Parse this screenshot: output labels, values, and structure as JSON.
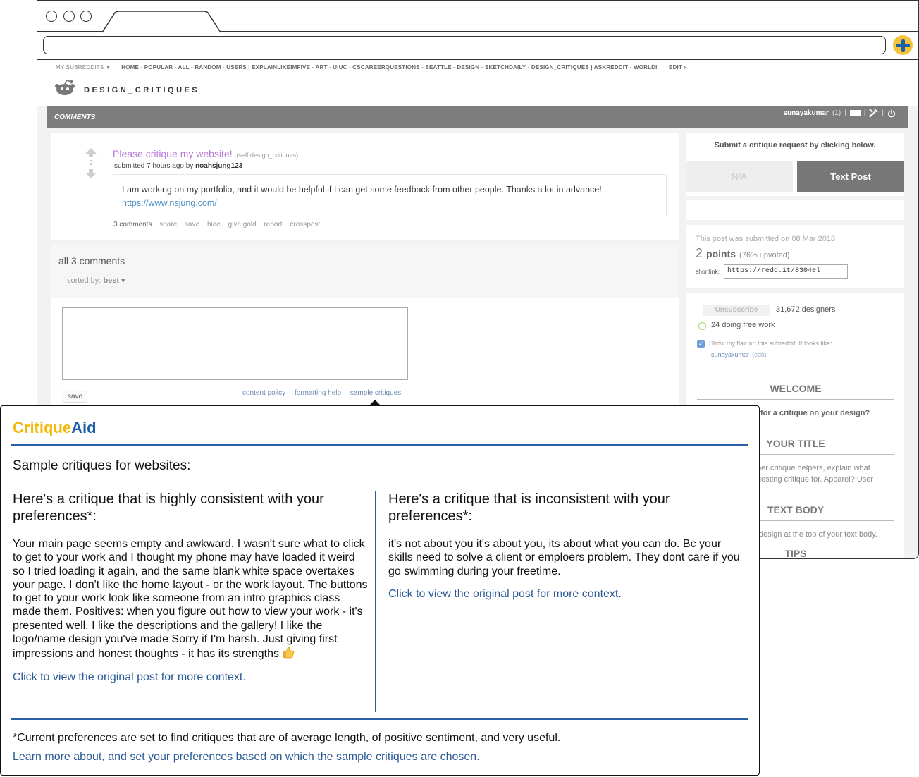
{
  "browser": {
    "address": ""
  },
  "reddit": {
    "srbar": {
      "my_subreddits": "MY SUBREDDITS ▼",
      "links": "HOME - POPULAR - ALL - RANDOM - USERS  |  EXPLAINLIKEIMFIVE - ART - UIUC - CSCAREERQUESTIONS - SEATTLE - DESIGN - SKETCHDAILY - DESIGN_CRITIQUES  |  ASKREDDIT - WORLDI",
      "edit": "EDIT »"
    },
    "subreddit_name": "DESIGN_CRITIQUES",
    "tab": "COMMENTS",
    "user": {
      "name": "sunayakumar",
      "karma": "(1)"
    },
    "post": {
      "score": "2",
      "title": "Please critique my website!",
      "domain": "(self.design_critiques)",
      "submitted_prefix": "submitted 7 hours ago by",
      "author": "noahsjung123",
      "selftext": "I am working on my portfolio, and it would be helpful if I can get some feedback from other people. Thanks a lot in advance!",
      "link": "https://www.nsjung.com/",
      "actions": [
        "3 comments",
        "share",
        "save",
        "hide",
        "give gold",
        "report",
        "crosspost"
      ]
    },
    "comments": {
      "all_label": "all 3 comments",
      "sorted_label": "sorted by:",
      "sort_value": "best ▾",
      "save_label": "save",
      "links": [
        "content policy",
        "formatting help",
        "sample critiques"
      ]
    },
    "sidebar": {
      "cta": "Submit a critique request by clicking below.",
      "btn_na": "N/A",
      "btn_text": "Text Post",
      "submitted_on": "This post was submitted on 08 Mar 2018",
      "points_number": "2",
      "points_label": "points",
      "upvoted": "(76% upvoted)",
      "shortlink_label": "shortlink:",
      "shortlink": "https://redd.it/8304el",
      "unsubscribe": "Unsubscribe",
      "subscribers": "31,672 designers",
      "online": "24 doing free work",
      "flair_text": "Show my flair on this subreddit. It looks like:",
      "flair_user": "sunayakumar",
      "flair_edit": "(edit)",
      "welcome": "WELCOME",
      "q1": "for a critique on your design?",
      "your_title": "YOUR TITLE",
      "title_p1": "per critique helpers, explain what",
      "title_p2": "uesting critique for. Apparel? User",
      "text_body": "TEXT BODY",
      "body_p": "design at the top of your text body.",
      "tips": "TIPS"
    }
  },
  "popup": {
    "brand_part1": "Critique",
    "brand_part2": "Aid",
    "subtitle": "Sample critiques for websites:",
    "left": {
      "heading": "Here's a critique that is highly consistent with your preferences*:",
      "body": "Your main page seems empty and awkward. I wasn't sure what to click to get to your work and I thought my phone may have loaded it weird so I tried loading it again, and the same blank white space overtakes your page. I don't like the home layout - or the work layout. The buttons to get to your work look like someone from an intro graphics class made them. Positives: when you figure out how to view your work - it's presented well. I like the descriptions and the gallery! I like the logo/name design you've made Sorry if I'm harsh. Just giving first impressions and honest thoughts - it has its strengths",
      "link": "Click to view the original post for more context."
    },
    "right": {
      "heading": "Here's a critique that is inconsistent with your preferences*:",
      "body": "it's not about you it's about you, its about what you can do. Bc your skills need to solve a client or emploers problem. They dont care if you go swimming during your freetime.",
      "link": "Click to view the original post for more context."
    },
    "footnote": "*Current preferences are set to find critiques that are of average length, of positive sentiment, and very useful.",
    "learn_more": "Learn more about, and set your preferences based on which the sample critiques are chosen."
  },
  "colors": {
    "brand_yellow": "#f5b90e",
    "brand_blue": "#1f5fa8",
    "link_blue": "#2c5b96",
    "post_title": "#b77ad6"
  }
}
